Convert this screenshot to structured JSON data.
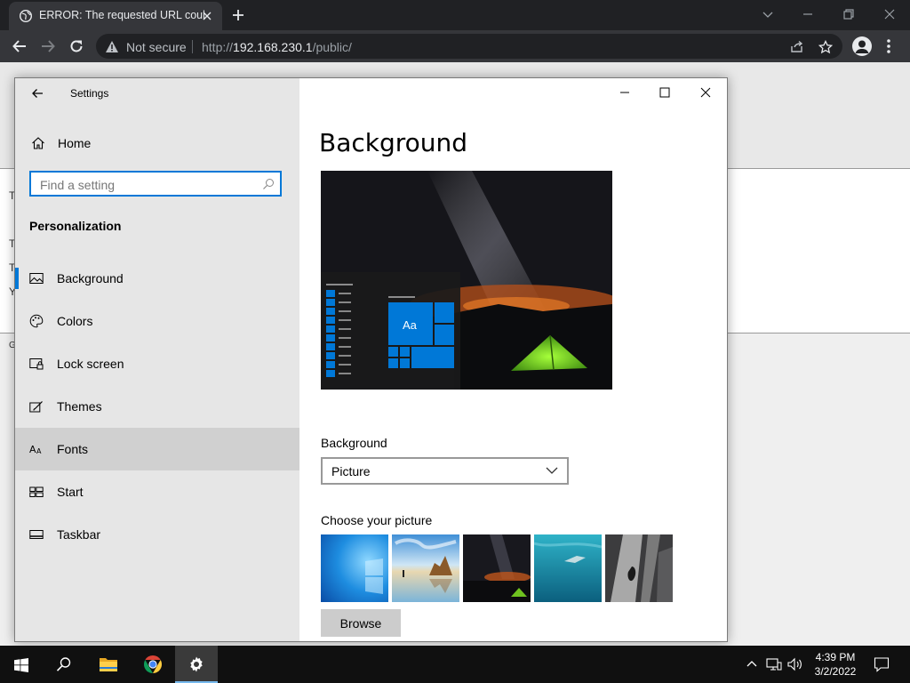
{
  "browser": {
    "tab_title": "ERROR: The requested URL could not be retrieved",
    "address": {
      "security_label": "Not secure",
      "scheme": "http://",
      "host": "192.168.230.1",
      "path": "/public/"
    }
  },
  "background_page": {
    "fragments": [
      "T",
      "T",
      "T",
      "Y",
      "G"
    ]
  },
  "settings": {
    "window_title": "Settings",
    "home_label": "Home",
    "search_placeholder": "Find a setting",
    "section_title": "Personalization",
    "nav_items": [
      {
        "label": "Background",
        "icon": "picture-icon"
      },
      {
        "label": "Colors",
        "icon": "palette-icon"
      },
      {
        "label": "Lock screen",
        "icon": "lock-screen-icon"
      },
      {
        "label": "Themes",
        "icon": "brush-icon"
      },
      {
        "label": "Fonts",
        "icon": "fonts-icon"
      },
      {
        "label": "Start",
        "icon": "start-tiles-icon"
      },
      {
        "label": "Taskbar",
        "icon": "taskbar-icon"
      }
    ],
    "selected_item": "Background",
    "hovered_item": "Fonts",
    "page_title": "Background",
    "preview_tile_text": "Aa",
    "background_label": "Background",
    "background_value": "Picture",
    "choose_picture_label": "Choose your picture",
    "pictures": [
      "windows-light",
      "beach-rocks",
      "night-tent",
      "underwater-swimmer",
      "rock-cliff"
    ],
    "browse_label": "Browse"
  },
  "taskbar": {
    "apps": [
      "start-icon",
      "search-icon",
      "file-explorer-icon",
      "chrome-icon",
      "settings-icon"
    ],
    "active_app": "settings-icon",
    "time": "4:39 PM",
    "date": "3/2/2022"
  },
  "colors": {
    "accent": "#0078d7",
    "tent_green": "#6fc21f"
  }
}
